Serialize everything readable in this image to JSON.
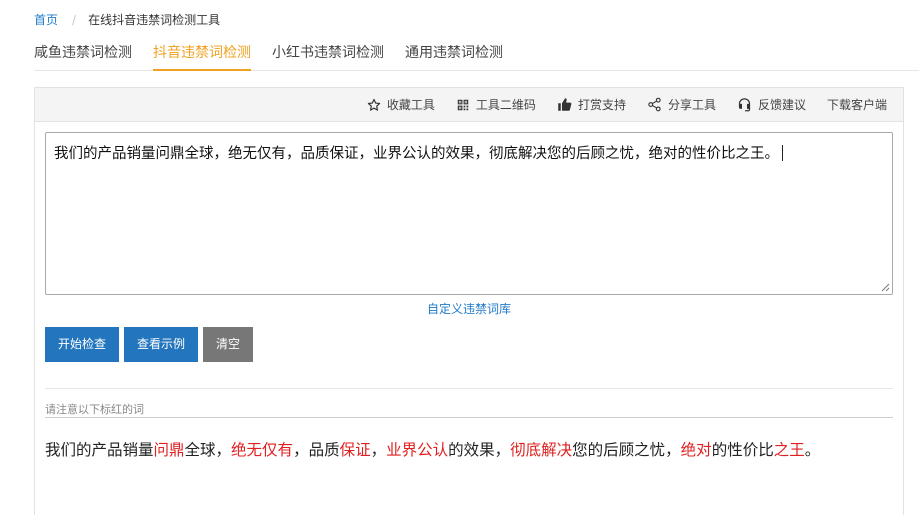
{
  "breadcrumb": {
    "home": "首页",
    "separator": "/",
    "current": "在线抖音违禁词检测工具"
  },
  "tabs": [
    {
      "label": "咸鱼违禁词检测",
      "active": false
    },
    {
      "label": "抖音违禁词检测",
      "active": true
    },
    {
      "label": "小红书违禁词检测",
      "active": false
    },
    {
      "label": "通用违禁词检测",
      "active": false
    }
  ],
  "toolbar": {
    "favorite": {
      "label": "收藏工具",
      "icon": "star-icon"
    },
    "qrcode": {
      "label": "工具二维码",
      "icon": "qrcode-icon"
    },
    "tip": {
      "label": "打赏支持",
      "icon": "thumbs-up-icon"
    },
    "share": {
      "label": "分享工具",
      "icon": "share-icon"
    },
    "feedback": {
      "label": "反馈建议",
      "icon": "headset-icon"
    },
    "download": {
      "label": "下载客户端"
    }
  },
  "editor": {
    "value": "我们的产品销量问鼎全球，绝无仅有，品质保证，业界公认的效果，彻底解决您的后顾之忧，绝对的性价比之王。"
  },
  "custom_library_link": "自定义违禁词库",
  "buttons": {
    "start": "开始检查",
    "example": "查看示例",
    "clear": "清空"
  },
  "notice": "请注意以下标红的词",
  "result": {
    "segments": [
      {
        "text": "我们的产品销量",
        "flag": false
      },
      {
        "text": "问鼎",
        "flag": true
      },
      {
        "text": "全球，",
        "flag": false
      },
      {
        "text": "绝无仅有",
        "flag": true
      },
      {
        "text": "，品质",
        "flag": false
      },
      {
        "text": "保证",
        "flag": true
      },
      {
        "text": "，",
        "flag": false
      },
      {
        "text": "业界公认",
        "flag": true
      },
      {
        "text": "的效果，",
        "flag": false
      },
      {
        "text": "彻底解决",
        "flag": true
      },
      {
        "text": "您的后顾之忧，",
        "flag": false
      },
      {
        "text": "绝对",
        "flag": true
      },
      {
        "text": "的性价比",
        "flag": false
      },
      {
        "text": "之王",
        "flag": true
      },
      {
        "text": "。",
        "flag": false
      }
    ]
  },
  "colors": {
    "accent_tab": "#f0a020",
    "link": "#1f7ac8",
    "primary_button": "#2376be",
    "clear_button": "#777777",
    "highlight": "#e02020"
  }
}
